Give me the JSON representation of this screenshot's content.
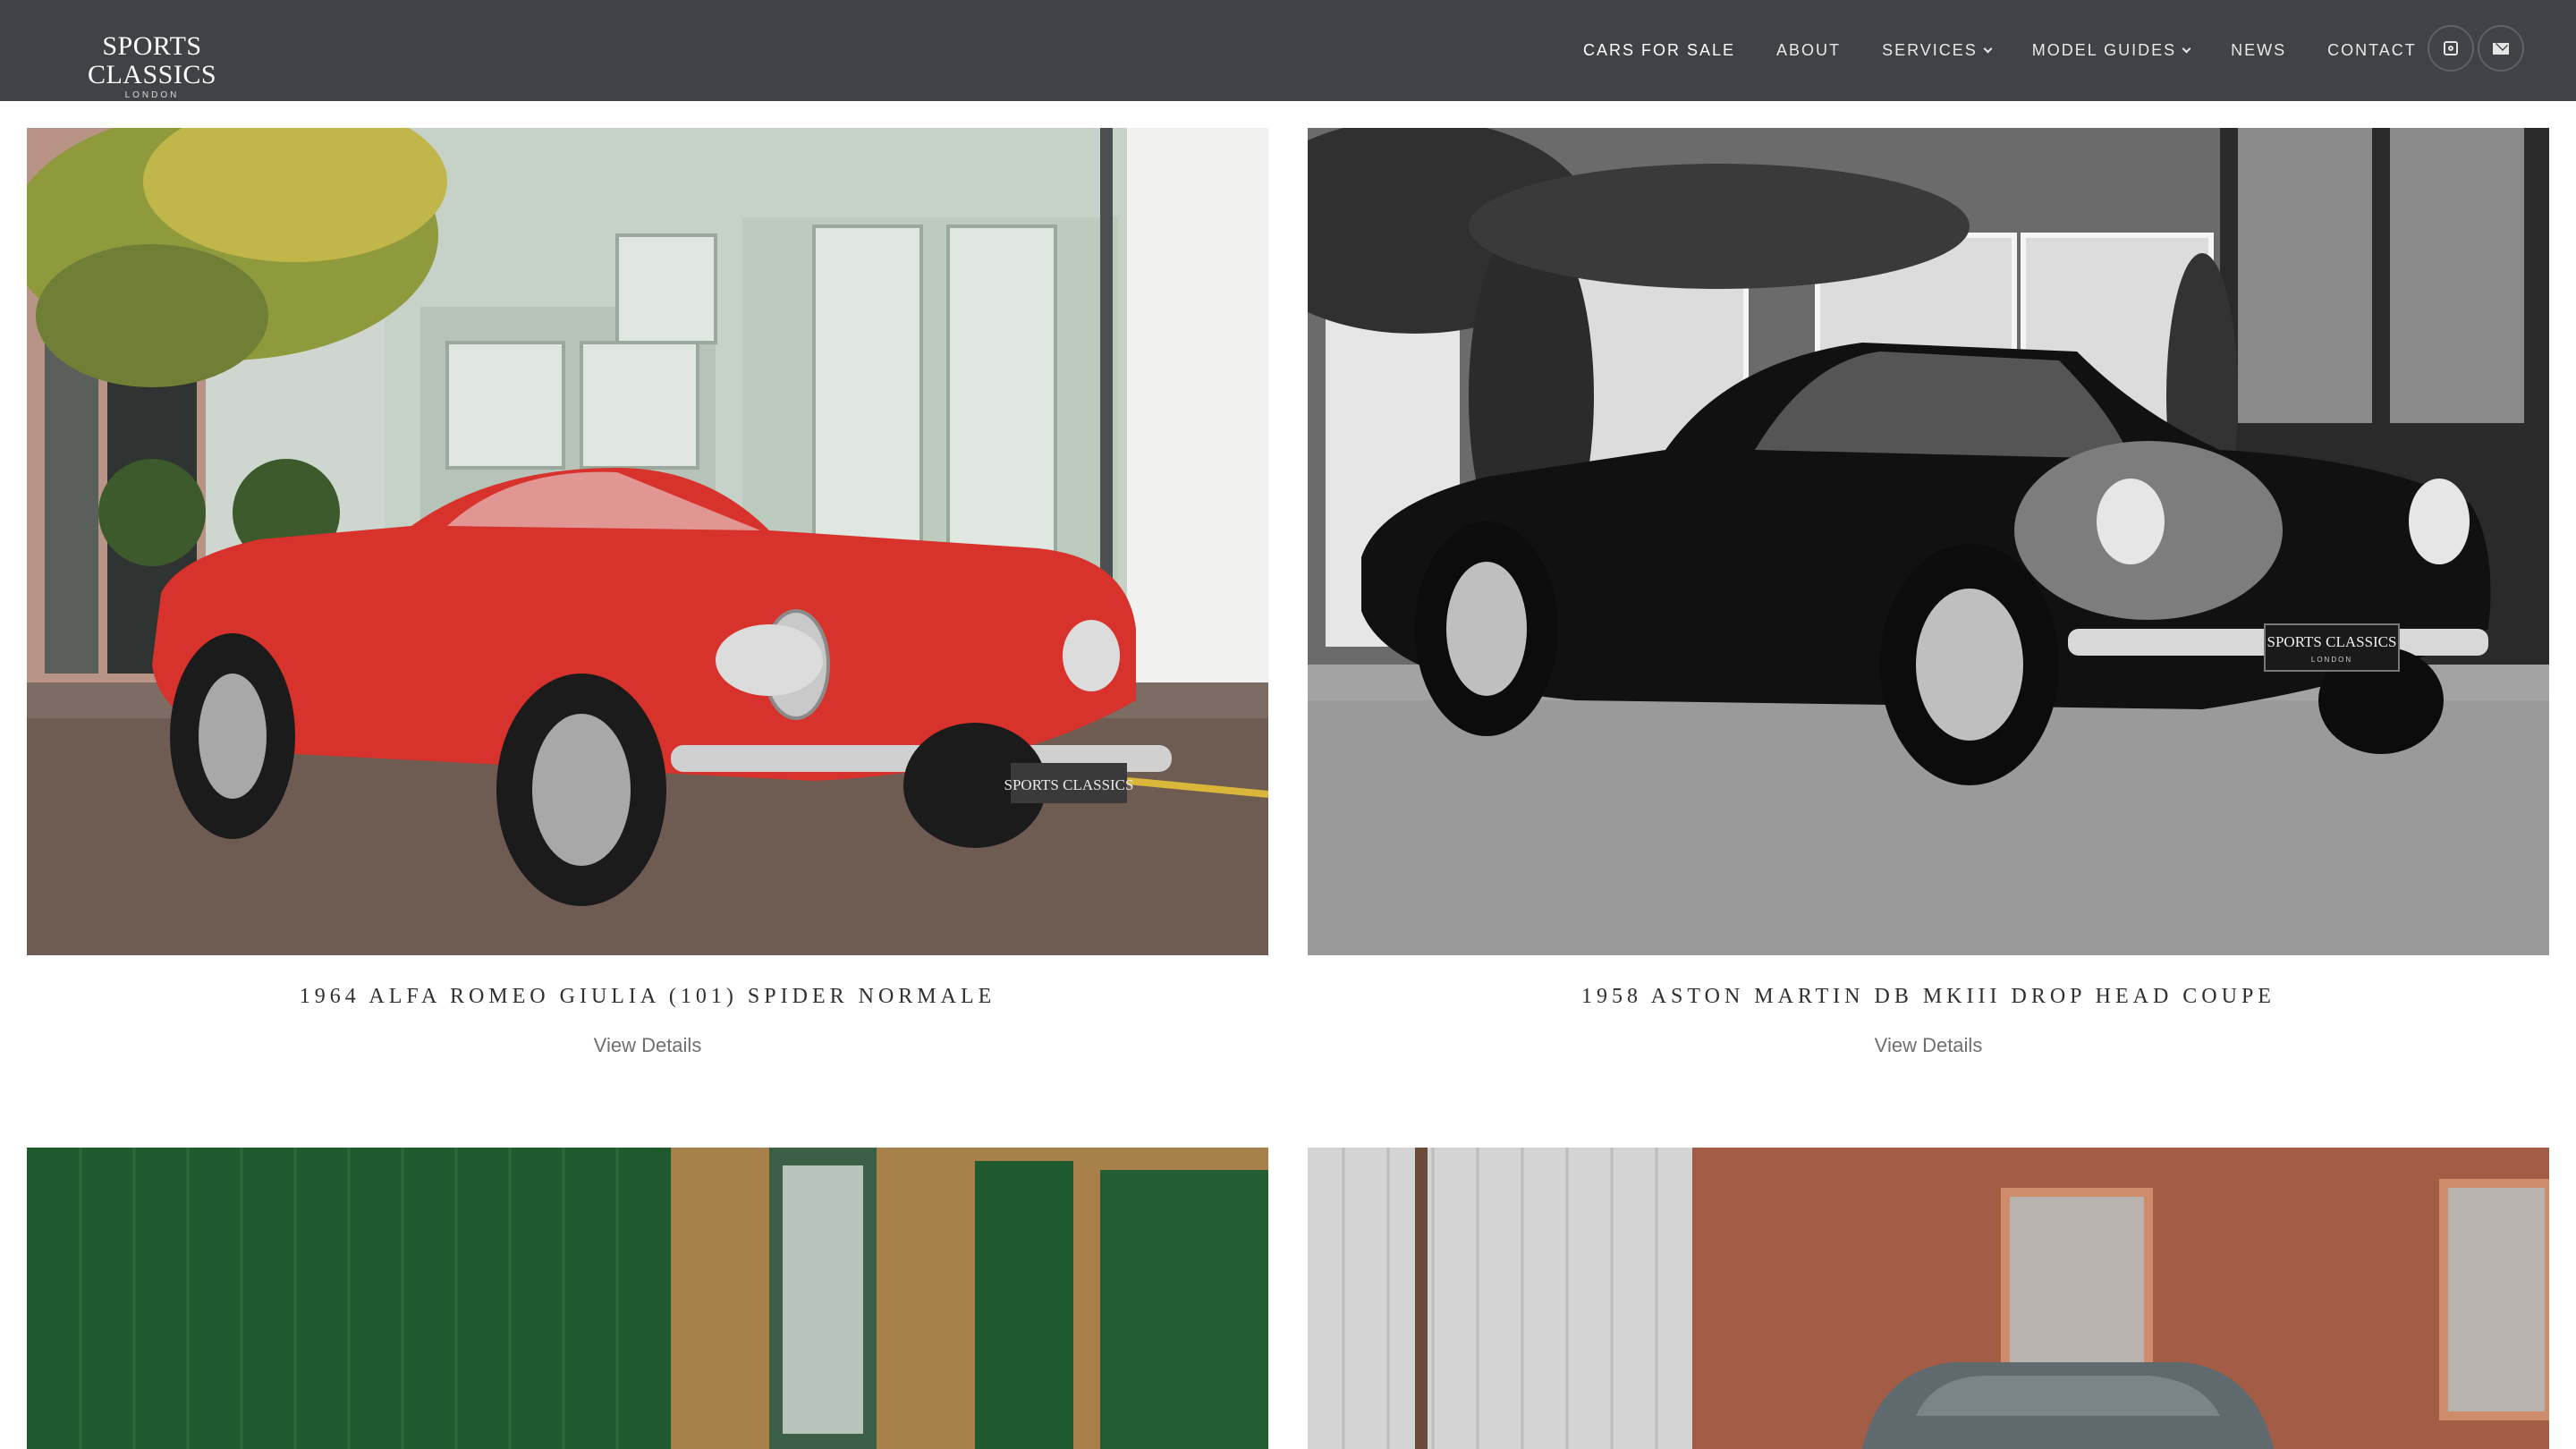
{
  "brand": {
    "name": "SPORTS CLASSICS",
    "tagline": "LONDON"
  },
  "nav": {
    "items": [
      {
        "label": "CARS FOR SALE",
        "active": true
      },
      {
        "label": "ABOUT"
      },
      {
        "label": "SERVICES",
        "dropdown": true
      },
      {
        "label": "MODEL GUIDES",
        "dropdown": true
      },
      {
        "label": "NEWS"
      },
      {
        "label": "CONTACT"
      }
    ],
    "social_icons": [
      "instagram-icon",
      "mail-icon"
    ]
  },
  "listings": [
    {
      "title": "1964 ALFA ROMEO GIULIA (101) SPIDER NORMALE",
      "link": "View Details",
      "plate": "SPORTS CLASSICS"
    },
    {
      "title": "1958 ASTON MARTIN DB MKIII DROP HEAD COUPE",
      "link": "View Details",
      "plate": "SPORTS CLASSICS",
      "plate_sub": "LONDON"
    },
    {
      "title": ""
    },
    {
      "title": ""
    }
  ],
  "colors": {
    "header_bg": "#3f4246",
    "alfa_red": "#d8322c",
    "aston_black": "#111111",
    "garage_green": "#1f5a2e"
  }
}
